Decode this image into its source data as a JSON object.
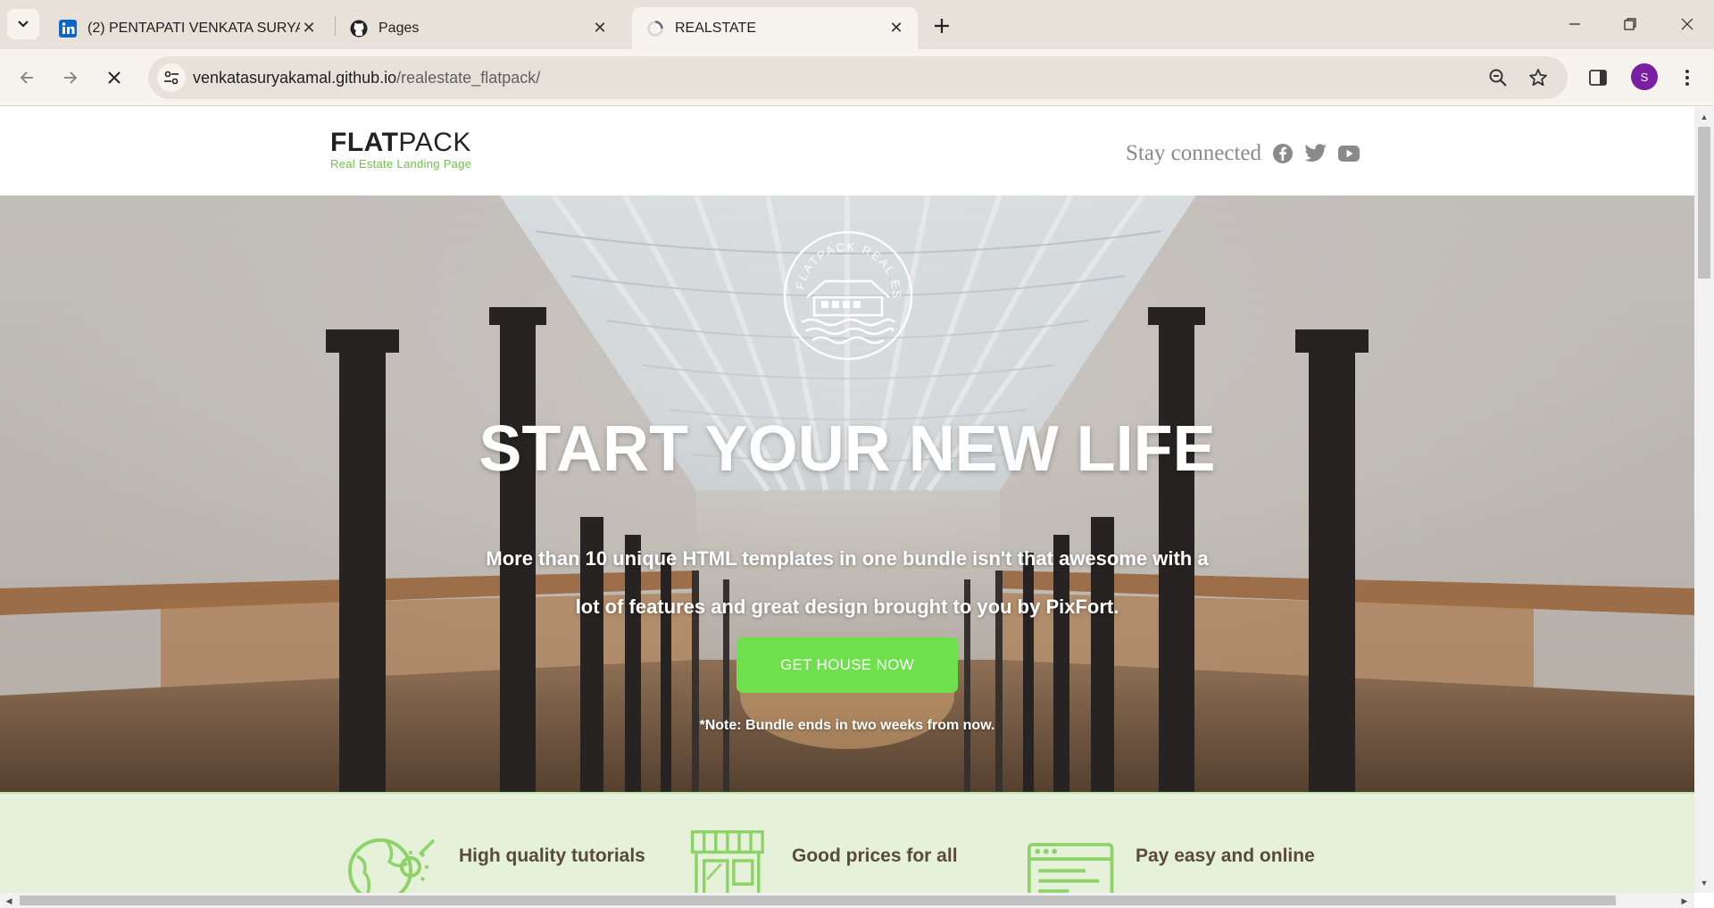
{
  "browser": {
    "tabs": [
      {
        "title": "(2) PENTAPATI VENKATA SURYA",
        "icon": "linkedin-icon",
        "active": false
      },
      {
        "title": "Pages",
        "icon": "github-icon",
        "active": false
      },
      {
        "title": "REALSTATE",
        "icon": "loading-icon",
        "active": true
      }
    ],
    "url_host": "venkatasuryakamal.github.io",
    "url_path": "/realestate_flatpack/",
    "profile_initial": "S"
  },
  "site": {
    "logo": {
      "bold": "FLAT",
      "light": "PACK",
      "tagline": "Real Estate Landing Page"
    },
    "social_label": "Stay connected",
    "social_icons": [
      "facebook-icon",
      "twitter-icon",
      "youtube-icon"
    ],
    "hero": {
      "emblem_text": "FLATPACK REAL ESTATE",
      "title": "START YOUR NEW LIFE",
      "text_line1": "More than 10 unique HTML templates in one bundle isn't that awesome with a",
      "text_line2": "lot of features and great design brought to you by PixFort.",
      "button": "GET HOUSE NOW",
      "note": "*Note: Bundle ends in two weeks from now."
    },
    "features": [
      {
        "title": "High quality tutorials",
        "icon": "globe-icon"
      },
      {
        "title": "Good prices for all",
        "icon": "storefront-icon"
      },
      {
        "title": "Pay easy and online",
        "icon": "browser-window-icon"
      }
    ],
    "accent_color": "#6ee04c"
  }
}
